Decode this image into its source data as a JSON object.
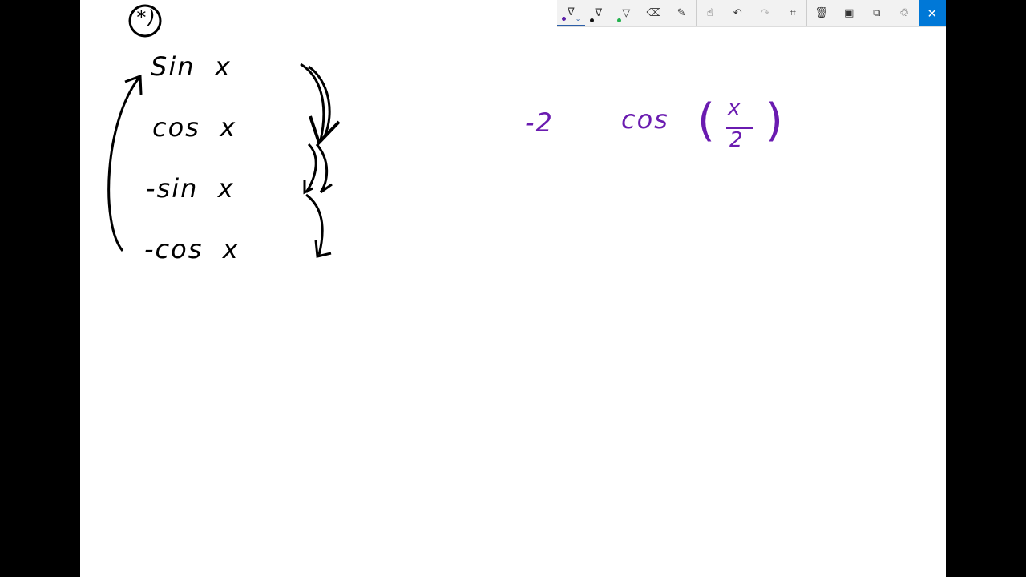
{
  "toolbar": {
    "tools": [
      {
        "name": "ballpoint-pen",
        "icon": "pen-icon",
        "color": "#5b1fa8",
        "active": true
      },
      {
        "name": "pencil",
        "icon": "pencil-icon",
        "color": "#111111"
      },
      {
        "name": "highlighter",
        "icon": "highlighter-icon",
        "color": "#22b14c"
      },
      {
        "name": "eraser",
        "icon": "eraser-icon"
      },
      {
        "name": "ruler",
        "icon": "ruler-icon"
      },
      {
        "name": "touch-writing",
        "icon": "touch-icon"
      },
      {
        "name": "undo",
        "icon": "undo-icon"
      },
      {
        "name": "redo",
        "icon": "redo-icon"
      },
      {
        "name": "crop",
        "icon": "crop-icon"
      },
      {
        "name": "clear",
        "icon": "trash-icon"
      },
      {
        "name": "save",
        "icon": "save-icon"
      },
      {
        "name": "copy",
        "icon": "copy-icon"
      },
      {
        "name": "share",
        "icon": "share-icon"
      },
      {
        "name": "close",
        "icon": "close-icon"
      }
    ],
    "accent": "#0078d7"
  },
  "ink": {
    "label": "(*)",
    "lines": [
      "Sin  x",
      "cos  x",
      "-sin  x",
      "-cos  x"
    ],
    "expression": [
      "-2",
      "cos",
      "(",
      "x",
      "2",
      ")"
    ],
    "black": "#000000",
    "purple": "#6a1bb0"
  }
}
